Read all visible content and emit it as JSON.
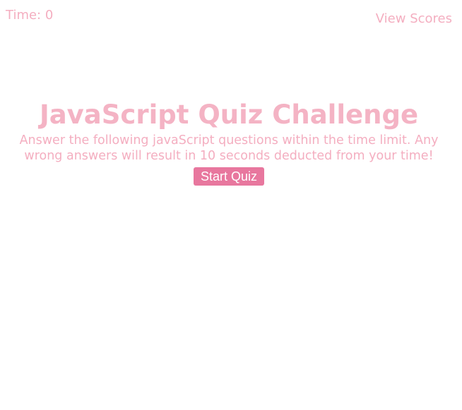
{
  "header": {
    "timer_text": "Time: 0",
    "view_scores_label": "View Scores"
  },
  "intro": {
    "title": "JavaScript Quiz Challenge",
    "description": "Answer the following javaScript questions within the time limit. Any wrong answers will result in 10 seconds deducted from your time!",
    "start_button_label": "Start Quiz"
  },
  "colors": {
    "text_pink": "#f4aec0",
    "button_pink": "#e8779e",
    "background": "#ffffff"
  }
}
